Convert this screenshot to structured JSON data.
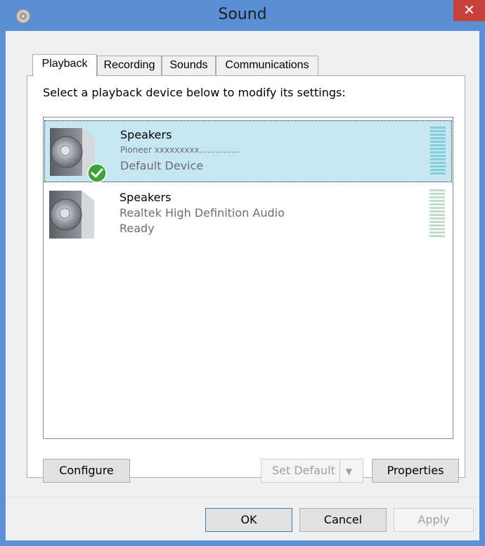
{
  "window": {
    "title": "Sound",
    "close_label": "✕",
    "icon": "sound-settings-icon"
  },
  "tabs": [
    {
      "label": "Playback",
      "active": true
    },
    {
      "label": "Recording",
      "active": false
    },
    {
      "label": "Sounds",
      "active": false
    },
    {
      "label": "Communications",
      "active": false
    }
  ],
  "instruction": "Select a playback device below to modify its settings:",
  "devices": [
    {
      "name": "Speakers",
      "description": "Pioneer xxxxxxxxx...............",
      "status": "Default Device",
      "selected": true,
      "default_badge": "green-check-icon"
    },
    {
      "name": "Speakers",
      "description": "Realtek High Definition Audio",
      "status": "Ready",
      "selected": false
    }
  ],
  "buttons": {
    "configure": "Configure",
    "set_default": "Set Default",
    "set_default_arrow": "▼",
    "properties": "Properties",
    "ok": "OK",
    "cancel": "Cancel",
    "apply": "Apply"
  },
  "colors": {
    "titlebar": "#5a8fd6",
    "close": "#c7413a",
    "selected_row": "#c6e6f4"
  }
}
